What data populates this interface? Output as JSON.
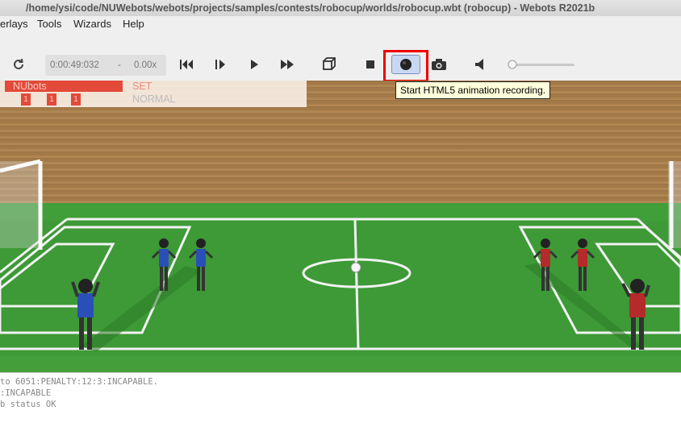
{
  "window": {
    "title": "/home/ysi/code/NUWebots/webots/projects/samples/contests/robocup/worlds/robocup.wbt (robocup) - Webots R2021b"
  },
  "menu": [
    {
      "label": "erlays"
    },
    {
      "label": "Tools"
    },
    {
      "label": "Wizards"
    },
    {
      "label": "Help"
    }
  ],
  "toolbar": {
    "time": "0:00:49:032",
    "dash": "-",
    "speed": "0.00x",
    "tooltip": "Start HTML5 animation recording."
  },
  "overlay": {
    "team_left": "NUbots",
    "state": "SET",
    "substate": "NORMAL",
    "scores": [
      "1",
      "1",
      "1"
    ]
  },
  "console": {
    "lines": [
      "to 6051:PENALTY:12:3:INCAPABLE.",
      ":INCAPABLE",
      "b status OK"
    ]
  },
  "colors": {
    "accent_red": "#e00000",
    "grass": "#3a8d35",
    "wall": "#a57b45",
    "team_blue": "#2b4fb8",
    "team_red": "#b52a2a"
  }
}
